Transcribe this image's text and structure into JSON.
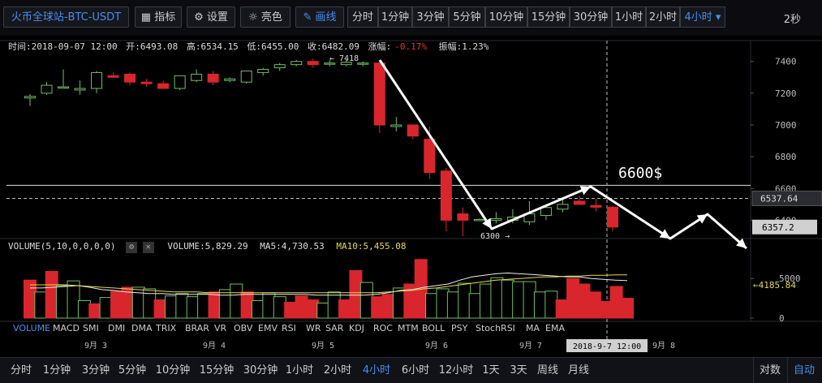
{
  "toolbar": {
    "symbol": "火币全球站-BTC-USDT",
    "indicators": "指标",
    "settings": "设置",
    "brightness": "亮色",
    "draw": "画线",
    "timeframes": [
      "分时",
      "1分钟",
      "3分钟",
      "5分钟",
      "10分钟",
      "15分钟",
      "30分钟",
      "1小时",
      "2小时",
      "4小时"
    ],
    "seconds": "2秒"
  },
  "info": {
    "time": "时间:2018-09-07 12:00",
    "open": "开:6493.08",
    "high": "高:6534.15",
    "low": "低:6455.00",
    "close": "收:6482.09",
    "change_label": "涨幅:",
    "change_value": "-0.17%",
    "amplitude": "振幅:1.23%"
  },
  "volume_legend": {
    "label": "VOLUME(5,10,0,0,0,0)",
    "volume": "VOLUME:5,829.29",
    "ma5": "MA5:4,730.53",
    "ma10": "MA10:5,455.08"
  },
  "indicators": [
    "VOLUME",
    "MACD",
    "SMI",
    "DMI",
    "DMA",
    "TRIX",
    "BRAR",
    "VR",
    "OBV",
    "EMV",
    "RSI",
    "WR",
    "SAR",
    "KDJ",
    "ROC",
    "MTM",
    "BOLL",
    "PSY",
    "StochRSI",
    "MA",
    "EMA"
  ],
  "bottom": {
    "periods": [
      "分时",
      "1分钟",
      "3分钟",
      "5分钟",
      "10分钟",
      "15分钟",
      "30分钟",
      "1小时",
      "2小时",
      "4小时",
      "6小时",
      "12小时",
      "1天",
      "3天",
      "周线",
      "月线"
    ],
    "log": "对数",
    "auto": "自动"
  },
  "chart_data": [
    {
      "type": "candlestick",
      "y_ticks": [
        "7400",
        "7200",
        "7000",
        "6800",
        "6600",
        "6400"
      ],
      "ylim": [
        6310,
        7460
      ],
      "x_labels": [
        "9月 3",
        "9月 4",
        "9月 5",
        "9月 6",
        "9月 7",
        "9月 8"
      ],
      "crosshair_x_label": "2018-9-7 12:00",
      "price_tags": {
        "crosshair": "6537.64",
        "last": "6357.2"
      },
      "annotations": {
        "high_marker": "← 7418",
        "low_marker": "6300 →",
        "target_price": "6600$"
      },
      "candles": [
        {
          "o": 7170,
          "h": 7195,
          "l": 7120,
          "c": 7180
        },
        {
          "o": 7200,
          "h": 7270,
          "l": 7190,
          "c": 7250
        },
        {
          "o": 7240,
          "h": 7350,
          "l": 7230,
          "c": 7240
        },
        {
          "o": 7220,
          "h": 7280,
          "l": 7190,
          "c": 7230
        },
        {
          "o": 7230,
          "h": 7340,
          "l": 7200,
          "c": 7330
        },
        {
          "o": 7310,
          "h": 7330,
          "l": 7300,
          "c": 7300
        },
        {
          "o": 7320,
          "h": 7330,
          "l": 7250,
          "c": 7270
        },
        {
          "o": 7270,
          "h": 7290,
          "l": 7240,
          "c": 7260
        },
        {
          "o": 7260,
          "h": 7280,
          "l": 7230,
          "c": 7230
        },
        {
          "o": 7230,
          "h": 7310,
          "l": 7220,
          "c": 7310
        },
        {
          "o": 7280,
          "h": 7350,
          "l": 7270,
          "c": 7320
        },
        {
          "o": 7320,
          "h": 7340,
          "l": 7250,
          "c": 7270
        },
        {
          "o": 7280,
          "h": 7300,
          "l": 7270,
          "c": 7290
        },
        {
          "o": 7270,
          "h": 7340,
          "l": 7260,
          "c": 7340
        },
        {
          "o": 7330,
          "h": 7360,
          "l": 7310,
          "c": 7350
        },
        {
          "o": 7360,
          "h": 7390,
          "l": 7340,
          "c": 7380
        },
        {
          "o": 7380,
          "h": 7410,
          "l": 7370,
          "c": 7400
        },
        {
          "o": 7400,
          "h": 7418,
          "l": 7360,
          "c": 7380
        },
        {
          "o": 7385,
          "h": 7410,
          "l": 7370,
          "c": 7390
        },
        {
          "o": 7380,
          "h": 7410,
          "l": 7370,
          "c": 7395
        },
        {
          "o": 7385,
          "h": 7400,
          "l": 7370,
          "c": 7390
        },
        {
          "o": 7390,
          "h": 7400,
          "l": 6950,
          "c": 7000
        },
        {
          "o": 6990,
          "h": 7050,
          "l": 6960,
          "c": 7000
        },
        {
          "o": 7000,
          "h": 7000,
          "l": 6910,
          "c": 6930
        },
        {
          "o": 6910,
          "h": 6990,
          "l": 6660,
          "c": 6700
        },
        {
          "o": 6710,
          "h": 6730,
          "l": 6330,
          "c": 6400
        },
        {
          "o": 6440,
          "h": 6480,
          "l": 6300,
          "c": 6400
        },
        {
          "o": 6400,
          "h": 6410,
          "l": 6400,
          "c": 6405
        },
        {
          "o": 6400,
          "h": 6450,
          "l": 6380,
          "c": 6410
        },
        {
          "o": 6400,
          "h": 6470,
          "l": 6380,
          "c": 6420
        },
        {
          "o": 6390,
          "h": 6520,
          "l": 6370,
          "c": 6440
        },
        {
          "o": 6430,
          "h": 6500,
          "l": 6400,
          "c": 6480
        },
        {
          "o": 6470,
          "h": 6530,
          "l": 6450,
          "c": 6500
        },
        {
          "o": 6520,
          "h": 6550,
          "l": 6500,
          "c": 6500
        },
        {
          "o": 6493,
          "h": 6534,
          "l": 6455,
          "c": 6482
        },
        {
          "o": 6482,
          "h": 6490,
          "l": 6330,
          "c": 6357
        }
      ]
    },
    {
      "type": "bar",
      "title": "VOLUME(5,10,0,0,0,0)",
      "y_ticks": [
        "5000",
        "0"
      ],
      "ylim": [
        0,
        8200
      ],
      "latest_ma_tag": "←4185.84",
      "volumes": [
        4800,
        3300,
        5900,
        4100,
        4700,
        2200,
        1800,
        2600,
        3400,
        3900,
        3900,
        3700,
        2300,
        2800,
        3100,
        2700,
        3100,
        3300,
        3600,
        4300,
        3300,
        2200,
        3200,
        2700,
        2000,
        2800,
        2300,
        1900,
        3300,
        2300,
        6000,
        4500,
        2700,
        3000,
        3800,
        4300,
        7400,
        3100,
        3700,
        3300,
        4400,
        3100,
        4300,
        5100,
        4800,
        4600,
        4600,
        3300,
        3400,
        2300,
        5000,
        4300,
        3300,
        2100,
        4000,
        2500
      ],
      "colors": [
        "r",
        "g",
        "r",
        "g",
        "g",
        "g",
        "r",
        "g",
        "r",
        "r",
        "g",
        "g",
        "r",
        "g",
        "g",
        "g",
        "g",
        "r",
        "g",
        "g",
        "r",
        "g",
        "g",
        "g",
        "r",
        "r",
        "r",
        "g",
        "g",
        "r",
        "r",
        "g",
        "r",
        "r",
        "g",
        "r",
        "r",
        "g",
        "g",
        "g",
        "g",
        "g",
        "g",
        "g",
        "g",
        "g",
        "g",
        "g",
        "g",
        "r",
        "r",
        "r",
        "r",
        "r",
        "r",
        "r"
      ],
      "ma_white": [
        3800,
        3800,
        3900,
        4000,
        4100,
        3900,
        3600,
        3500,
        3300,
        3200,
        3100,
        3100,
        3000,
        3000,
        3000,
        3000,
        2900,
        2900,
        3000,
        3000,
        3000,
        3000,
        3000,
        3000,
        2900,
        2900,
        2900,
        2900,
        2900,
        3000,
        3200,
        3500,
        3600,
        3900,
        4100,
        4300,
        4800,
        5200,
        5400,
        5600,
        5700,
        5600,
        5500,
        5400,
        5300,
        5200,
        5200,
        5000,
        4900,
        4800,
        4731
      ],
      "ma_yellow": [
        4200,
        4200,
        4200,
        4200,
        4100,
        4000,
        3900,
        3800,
        3700,
        3600,
        3500,
        3400,
        3300,
        3300,
        3300,
        3200,
        3200,
        3200,
        3200,
        3200,
        3200,
        3200,
        3200,
        3200,
        3200,
        3200,
        3200,
        3200,
        3200,
        3200,
        3300,
        3400,
        3500,
        3700,
        3800,
        4000,
        4200,
        4400,
        4600,
        4800,
        4900,
        5000,
        5100,
        5200,
        5200,
        5300,
        5300,
        5400,
        5400,
        5450,
        5455
      ]
    }
  ]
}
